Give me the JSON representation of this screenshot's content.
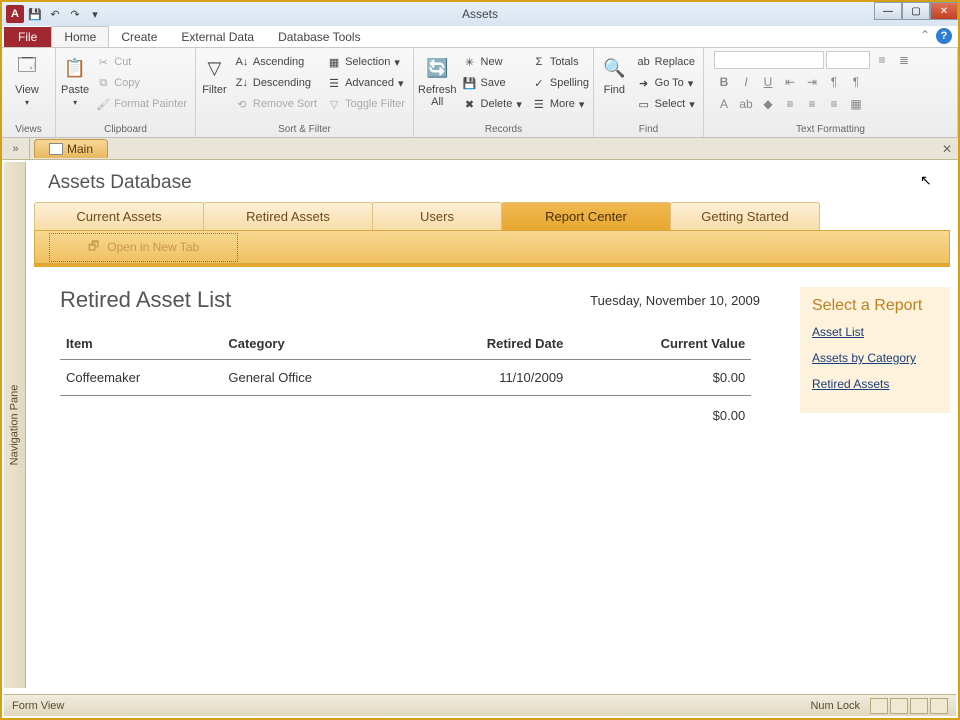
{
  "window": {
    "title": "Assets"
  },
  "qat": {
    "save": "💾",
    "undo": "↶",
    "redo": "↷"
  },
  "ribbon_tabs": {
    "file": "File",
    "home": "Home",
    "create": "Create",
    "external": "External Data",
    "dbtools": "Database Tools"
  },
  "ribbon": {
    "views": {
      "label": "Views",
      "view": "View"
    },
    "clipboard": {
      "label": "Clipboard",
      "paste": "Paste",
      "cut": "Cut",
      "copy": "Copy",
      "format_painter": "Format Painter"
    },
    "sort_filter": {
      "label": "Sort & Filter",
      "filter": "Filter",
      "asc": "Ascending",
      "desc": "Descending",
      "remove": "Remove Sort",
      "selection": "Selection",
      "advanced": "Advanced",
      "toggle": "Toggle Filter"
    },
    "records": {
      "label": "Records",
      "refresh": "Refresh All",
      "new": "New",
      "save": "Save",
      "delete": "Delete",
      "totals": "Totals",
      "spelling": "Spelling",
      "more": "More"
    },
    "find": {
      "label": "Find",
      "find": "Find",
      "replace": "Replace",
      "goto": "Go To",
      "select": "Select"
    },
    "text_fmt": {
      "label": "Text Formatting"
    }
  },
  "doc_tab": {
    "main": "Main"
  },
  "navpane": "Navigation Pane",
  "db": {
    "title": "Assets Database"
  },
  "main_tabs": {
    "current": "Current Assets",
    "retired": "Retired Assets",
    "users": "Users",
    "report": "Report Center",
    "getting": "Getting Started"
  },
  "subbar": {
    "open_new_tab": "Open in New Tab"
  },
  "report": {
    "title": "Retired Asset List",
    "date": "Tuesday, November 10, 2009",
    "cols": {
      "item": "Item",
      "category": "Category",
      "retired": "Retired Date",
      "value": "Current Value"
    },
    "rows": [
      {
        "item": "Coffeemaker",
        "category": "General Office",
        "retired": "11/10/2009",
        "value": "$0.00"
      }
    ],
    "total": "$0.00"
  },
  "side": {
    "title": "Select a Report",
    "links": {
      "asset_list": "Asset List",
      "by_cat": "Assets by Category",
      "retired": "Retired Assets"
    }
  },
  "status": {
    "left": "Form View",
    "right": "Num Lock"
  }
}
